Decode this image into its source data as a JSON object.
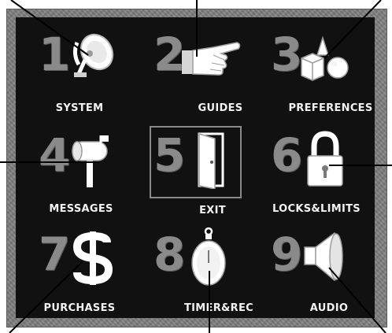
{
  "menu": {
    "items": [
      {
        "number": "1",
        "label": "SYSTEM",
        "icon": "satellite-dish-icon"
      },
      {
        "number": "2",
        "label": "GUIDES",
        "icon": "pointing-hand-icon"
      },
      {
        "number": "3",
        "label": "PREFERENCES",
        "icon": "shapes-icon"
      },
      {
        "number": "4",
        "label": "MESSAGES",
        "icon": "mailbox-icon"
      },
      {
        "number": "5",
        "label": "EXIT",
        "icon": "open-door-icon"
      },
      {
        "number": "6",
        "label": "LOCKS&LIMITS",
        "icon": "padlock-icon"
      },
      {
        "number": "7",
        "label": "PURCHASES",
        "icon": "dollar-sign-icon"
      },
      {
        "number": "8",
        "label": "TIMER&REC",
        "icon": "stopwatch-icon"
      },
      {
        "number": "9",
        "label": "AUDIO",
        "icon": "speaker-icon"
      }
    ],
    "selected_index": 4
  },
  "colors": {
    "panel_background": "#111111",
    "frame": "#7e7e7e",
    "number": "#8a8a8a",
    "label": "#f2f2f2",
    "icon": "#ffffff",
    "callout_line": "#000000"
  }
}
